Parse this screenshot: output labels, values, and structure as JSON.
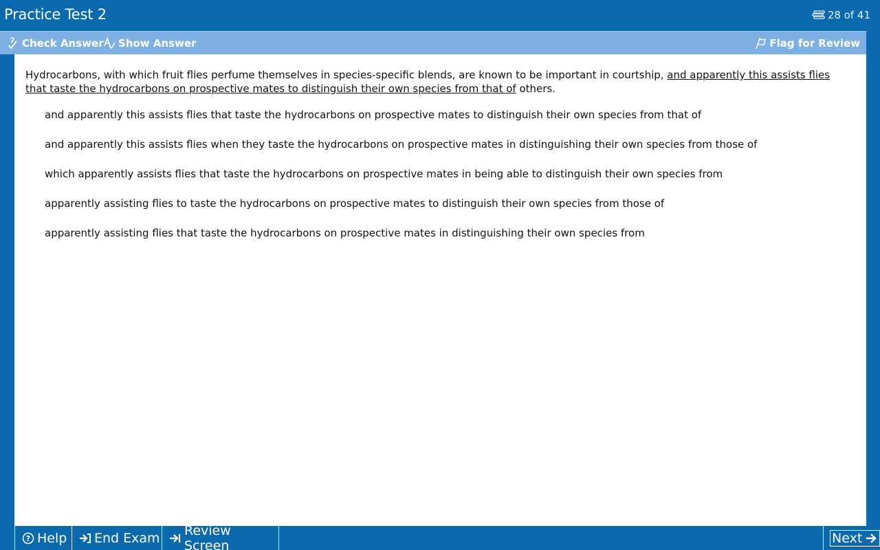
{
  "header": {
    "title": "Practice Test 2",
    "counter": "28 of 41",
    "counter_icon": "stacked-pages-icon"
  },
  "toolbar": {
    "check_answer_label": "Check Answer",
    "show_answer_label": "Show Answer",
    "flag_review_label": "Flag for Review"
  },
  "question": {
    "intro": "Hydrocarbons, with which fruit flies perfume themselves in species-specific blends, are known to be important in courtship, ",
    "underlined": "and apparently this assists flies that taste the hydrocarbons on prospective mates to distinguish their own species from that of",
    "outro": " others."
  },
  "choices": [
    "and apparently this assists flies that taste the hydrocarbons on prospective mates to distinguish their own species from that of",
    "and apparently this assists flies when they taste the hydrocarbons on prospective mates in distinguishing their own species from those of",
    "which apparently assists flies that taste the hydrocarbons on prospective mates in being able to distinguish their own species from",
    "apparently assisting flies to taste the hydrocarbons on prospective mates to distinguish their own species from those of",
    "apparently assisting flies that taste the hydrocarbons on prospective mates in distinguishing their own species from"
  ],
  "footer": {
    "help_label": "Help",
    "end_exam_label": "End Exam",
    "review_screen_label": "Review Screen",
    "next_label": "Next"
  },
  "colors": {
    "frame_blue": "#0b6aad",
    "toolbar_blue": "#7eb0e3"
  }
}
